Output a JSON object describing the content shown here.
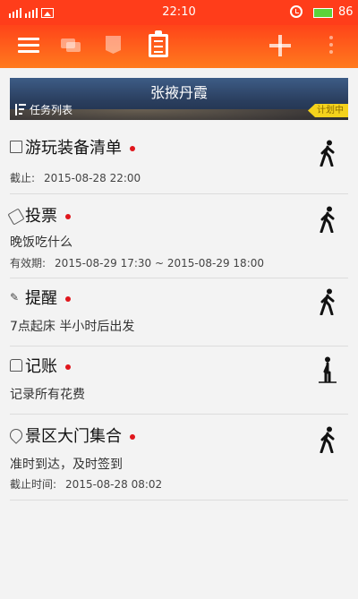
{
  "status_bar": {
    "time": "22:10",
    "battery": "86",
    "battery_color": "#5bd33a"
  },
  "toolbar": {
    "icons": [
      "menu-icon",
      "chat-icon",
      "badge-icon",
      "clipboard-icon",
      "plus-icon",
      "more-icon"
    ],
    "color": "#ff4a1b"
  },
  "banner": {
    "title": "张掖丹霞",
    "list_label": "任务列表",
    "tag": "计划中"
  },
  "tasks": [
    {
      "title": "游玩装备清单",
      "icon": "clipboard-icon",
      "meta_label": "截止:",
      "meta_value": "2015-08-28  22:00",
      "status_icon": "walking-icon"
    },
    {
      "title": "投票",
      "icon": "tag-icon",
      "desc": "晚饭吃什么",
      "meta_label": "有效期:",
      "meta_value": "2015-08-29 17:30 ~ 2015-08-29 18:00",
      "status_icon": "walking-icon"
    },
    {
      "title": "提醒",
      "icon": "horn-icon",
      "desc": "7点起床 半小时后出发",
      "status_icon": "walking-icon"
    },
    {
      "title": "记账",
      "icon": "bag-icon",
      "desc": "记录所有花费",
      "status_icon": "standing-icon"
    },
    {
      "title": "景区大门集合",
      "icon": "location-pin-icon",
      "desc": "准时到达，及时签到",
      "meta_label": "截止时间:",
      "meta_value": "2015-08-28  08:02",
      "status_icon": "walking-icon"
    }
  ],
  "accent_colors": {
    "dot": "#e0161c",
    "tag": "#f4d21c"
  }
}
